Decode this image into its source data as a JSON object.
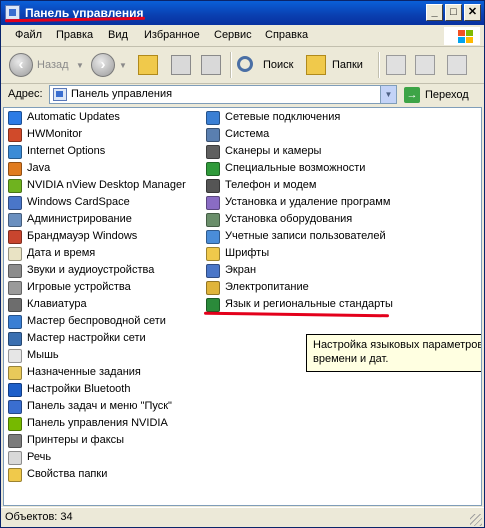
{
  "window": {
    "title": "Панель управления",
    "controls": {
      "minimize": "_",
      "maximize": "□",
      "close": "✕"
    }
  },
  "menu": [
    "Файл",
    "Правка",
    "Вид",
    "Избранное",
    "Сервис",
    "Справка"
  ],
  "toolbar": {
    "back": "Назад",
    "search": "Поиск",
    "folders": "Папки"
  },
  "address": {
    "label": "Адрес:",
    "value": "Панель управления",
    "go": "Переход"
  },
  "items_left": [
    {
      "label": "Automatic Updates",
      "icon": "automatic-updates-icon",
      "color": "#2c7be5"
    },
    {
      "label": "HWMonitor",
      "icon": "hwmonitor-icon",
      "color": "#d04a2a"
    },
    {
      "label": "Internet Options",
      "icon": "internet-options-icon",
      "color": "#3b8bd6"
    },
    {
      "label": "Java",
      "icon": "java-icon",
      "color": "#e07b1f"
    },
    {
      "label": "NVIDIA nView Desktop Manager",
      "icon": "nvidia-nview-icon",
      "color": "#6fb31f"
    },
    {
      "label": "Windows CardSpace",
      "icon": "windows-cardspace-icon",
      "color": "#4a76c8"
    },
    {
      "label": "Администрирование",
      "icon": "administration-icon",
      "color": "#6a8fbf"
    },
    {
      "label": "Брандмауэр Windows",
      "icon": "firewall-icon",
      "color": "#c8452e"
    },
    {
      "label": "Дата и время",
      "icon": "date-time-icon",
      "color": "#e9e3c4"
    },
    {
      "label": "Звуки и аудиоустройства",
      "icon": "sound-icon",
      "color": "#8c8c8c"
    },
    {
      "label": "Игровые устройства",
      "icon": "game-controller-icon",
      "color": "#9a9a9a"
    },
    {
      "label": "Клавиатура",
      "icon": "keyboard-icon",
      "color": "#6d6d6d"
    },
    {
      "label": "Мастер беспроводной сети",
      "icon": "wireless-network-icon",
      "color": "#3a7fd4"
    },
    {
      "label": "Мастер настройки сети",
      "icon": "network-setup-icon",
      "color": "#3a6fb0"
    },
    {
      "label": "Мышь",
      "icon": "mouse-icon",
      "color": "#e6e6e6"
    },
    {
      "label": "Назначенные задания",
      "icon": "scheduled-tasks-icon",
      "color": "#e8c95a"
    },
    {
      "label": "Настройки Bluetooth",
      "icon": "bluetooth-icon",
      "color": "#1d5fc9"
    },
    {
      "label": "Панель задач и меню \"Пуск\"",
      "icon": "taskbar-icon",
      "color": "#3a6ed0"
    },
    {
      "label": "Панель управления NVIDIA",
      "icon": "nvidia-control-panel-icon",
      "color": "#76b900"
    },
    {
      "label": "Принтеры и факсы",
      "icon": "printers-icon",
      "color": "#7b7b7b"
    },
    {
      "label": "Речь",
      "icon": "speech-icon",
      "color": "#d9d9d9"
    },
    {
      "label": "Свойства папки",
      "icon": "folder-options-icon",
      "color": "#f0c94b"
    }
  ],
  "items_right": [
    {
      "label": "Сетевые подключения",
      "icon": "network-connections-icon",
      "color": "#3a7fd4"
    },
    {
      "label": "Система",
      "icon": "system-icon",
      "color": "#5a7fb0"
    },
    {
      "label": "Сканеры и камеры",
      "icon": "scanners-cameras-icon",
      "color": "#5f5f5f"
    },
    {
      "label": "Специальные возможности",
      "icon": "accessibility-icon",
      "color": "#2f9a3a"
    },
    {
      "label": "Телефон и модем",
      "icon": "phone-modem-icon",
      "color": "#555555"
    },
    {
      "label": "Установка и удаление программ",
      "icon": "add-remove-programs-icon",
      "color": "#8a6cc4"
    },
    {
      "label": "Установка оборудования",
      "icon": "add-hardware-icon",
      "color": "#6b8f6b"
    },
    {
      "label": "Учетные записи пользователей",
      "icon": "user-accounts-icon",
      "color": "#4a8dd8"
    },
    {
      "label": "Шрифты",
      "icon": "fonts-icon",
      "color": "#f0c94b"
    },
    {
      "label": "Экран",
      "icon": "display-icon",
      "color": "#4a76c8"
    },
    {
      "label": "Электропитание",
      "icon": "power-options-icon",
      "color": "#e0b43a"
    },
    {
      "label": "Язык и региональные стандарты",
      "icon": "regional-language-icon",
      "color": "#2a8a3a"
    }
  ],
  "tooltip": {
    "line1": "Настройка языковых параметров,",
    "line2": "времени и дат."
  },
  "status": "Объектов: 34",
  "annotation_color": "#e3001b"
}
